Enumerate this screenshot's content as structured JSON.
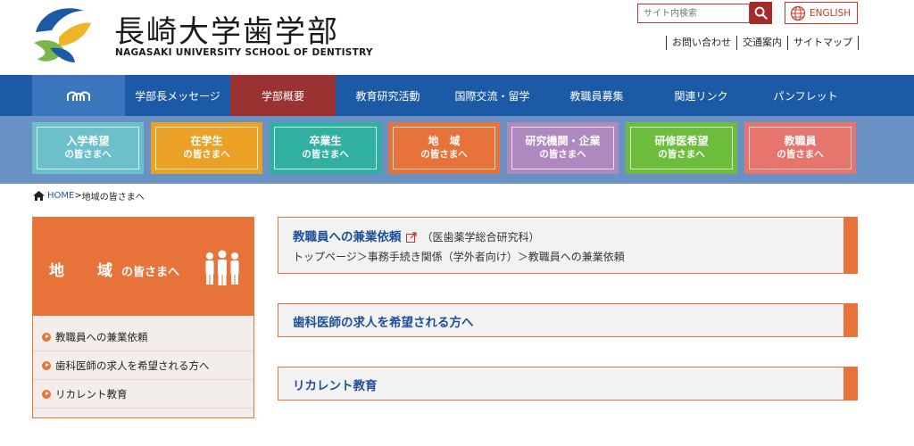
{
  "header": {
    "logo_title": "長崎大学歯学部",
    "logo_subtitle": "NAGASAKI UNIVERSITY SCHOOL OF DENTISTRY",
    "search_placeholder": "サイト内検索",
    "english_label": "ENGLISH",
    "util_links": [
      "お問い合わせ",
      "交通案内",
      "サイトマップ"
    ]
  },
  "nav": {
    "items": [
      "学部長メッセージ",
      "学部概要",
      "教育研究活動",
      "国際交流・留学",
      "教職員募集",
      "関連リンク",
      "パンフレット"
    ],
    "active": "学部概要"
  },
  "audience": [
    {
      "line1": "入学希望",
      "line2": "の皆さまへ",
      "color": "#6cc0cc"
    },
    {
      "line1": "在学生",
      "line2": "の皆さまへ",
      "color": "#eaa125"
    },
    {
      "line1": "卒業生",
      "line2": "の皆さまへ",
      "color": "#30b0a0"
    },
    {
      "line1": "地　域",
      "line2": "の皆さまへ",
      "color": "#e8733a"
    },
    {
      "line1": "研究機関・企業",
      "line2": "の皆さまへ",
      "color": "#b088c0"
    },
    {
      "line1": "研修医希望",
      "line2": "の皆さまへ",
      "color": "#6dbd3c"
    },
    {
      "line1": "教職員",
      "line2": "の皆さまへ",
      "color": "#e8746e"
    }
  ],
  "breadcrumb": {
    "home": "HOME",
    "separator": ">",
    "current": "地域の皆さまへ"
  },
  "sidebar": {
    "title_big": "地　域",
    "title_small": "の皆さまへ",
    "items": [
      "教職員への兼業依頼",
      "歯科医師の求人を希望される方へ",
      "リカレント教育"
    ]
  },
  "cards": [
    {
      "title": "教職員への兼業依頼",
      "extra": "（医歯薬学総合研究科）",
      "sub": "トップページ＞事務手続き関係（学外者向け）＞教職員への兼業依頼"
    },
    {
      "title": "歯科医師の求人を希望される方へ"
    },
    {
      "title": "リカレント教育"
    }
  ],
  "colors": {
    "nav_bg": "#1d5aa5",
    "nav_active": "#9b3232",
    "accent_orange": "#e8733a",
    "link_blue": "#1d4f9a"
  }
}
